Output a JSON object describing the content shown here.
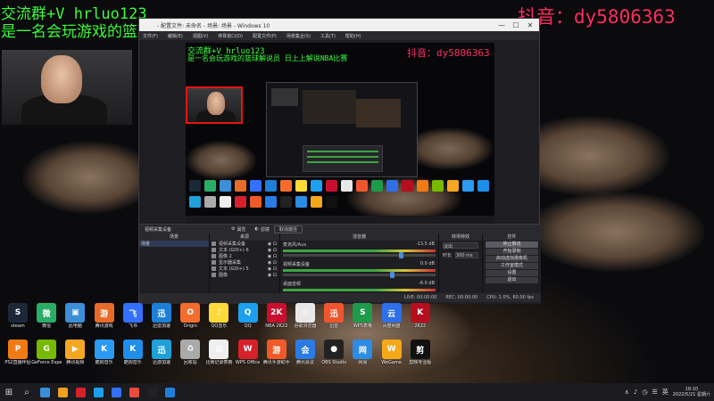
{
  "overlay": {
    "group_text": "交流群+V hrluo123",
    "intro_text": "是一名会玩游戏的篮球解说员，日上上解说NBA比赛",
    "douyin_text": "抖音：dy5806363"
  },
  "obs": {
    "window_title": "- 配置文件: 未命名 - 场景: 场景 - Windows 10",
    "window_buttons": [
      "—",
      "☐",
      "✕"
    ],
    "menu": [
      "文件(F)",
      "编辑(E)",
      "视图(V)",
      "停靠窗口(D)",
      "配置文件(P)",
      "场景集合(S)",
      "工具(T)",
      "帮助(H)"
    ],
    "preview": {
      "group_text": "交流群+V hrluo123",
      "intro_text": "是一名会玩游戏的篮球解说员 日上上解说NBA比赛",
      "douyin_text": "抖音：dy5806363"
    },
    "toolbar": {
      "source_name": "视频采集设备",
      "properties_label": "属性",
      "filters_label": "滤镜",
      "deactivate_label": "取消激活"
    },
    "docks": {
      "scenes": {
        "title": "场景",
        "items": [
          "场景"
        ]
      },
      "sources": {
        "title": "来源",
        "items": [
          "视频采集设备",
          "文本 (GDI+) 6",
          "图像 2",
          "显示器采集",
          "文本 (GDI+) 5",
          "图像"
        ]
      },
      "mixer": {
        "title": "混音器",
        "channels": [
          {
            "name": "麦克风/Aux",
            "db": "-13.5 dB",
            "level": 0.78
          },
          {
            "name": "视频采集设备",
            "db": "0.0 dB",
            "level": 0.72
          },
          {
            "name": "桌面音频",
            "db": "-6.0 dB",
            "level": 0.64
          }
        ]
      },
      "transitions": {
        "title": "转场特效",
        "type": "淡出",
        "duration_label": "时长",
        "duration": "300 ms"
      },
      "controls": {
        "title": "控件",
        "buttons": [
          "停止推流",
          "开始录制",
          "启动虚拟摄像机",
          "工作室模式",
          "设置",
          "退出"
        ]
      }
    },
    "status": {
      "live": "LIVE: 00:00:00",
      "rec": "REC: 00:00:00",
      "cpu": "CPU: 1.0%, 60.00 fps"
    },
    "footer_glyphs": [
      "+",
      "—",
      "∧",
      "∨"
    ]
  },
  "desktop_row1": [
    {
      "label": "steam",
      "color": "#1b2838",
      "glyph": "S"
    },
    {
      "label": "微信",
      "color": "#2aae67",
      "glyph": "微"
    },
    {
      "label": "此电脑",
      "color": "#3b8fd9",
      "glyph": "▣"
    },
    {
      "label": "腾讯游戏",
      "color": "#e86a2a",
      "glyph": "游"
    },
    {
      "label": "飞书",
      "color": "#3370ff",
      "glyph": "飞"
    },
    {
      "label": "迅雷加速",
      "color": "#1e7fd8",
      "glyph": "迅"
    },
    {
      "label": "Origin",
      "color": "#f56c2d",
      "glyph": "O"
    },
    {
      "label": "QQ音乐",
      "color": "#ffd93a",
      "glyph": "♪"
    },
    {
      "label": "QQ",
      "color": "#1ea0f0",
      "glyph": "Q"
    },
    {
      "label": "NBA 2K22",
      "color": "#c8102e",
      "glyph": "2K"
    },
    {
      "label": "谷歌浏览器",
      "color": "#e8e8e8",
      "glyph": "◎"
    },
    {
      "label": "迅雷",
      "color": "#f0562d",
      "glyph": "迅"
    },
    {
      "label": "WPS表格",
      "color": "#1e9a4b",
      "glyph": "S"
    },
    {
      "label": "百度网盘",
      "color": "#2f6fe8",
      "glyph": "云"
    },
    {
      "label": "2K22",
      "color": "#b50f1f",
      "glyph": "K"
    }
  ],
  "desktop_row2": [
    {
      "label": "PS2直播伴侣",
      "color": "#f07a14",
      "glyph": "P"
    },
    {
      "label": "GeForce Experience",
      "color": "#76b900",
      "glyph": "G"
    },
    {
      "label": "腾讯视频",
      "color": "#f5a623",
      "glyph": "▶"
    },
    {
      "label": "酷狗音乐",
      "color": "#2b9af3",
      "glyph": "K"
    },
    {
      "label": "酷狗音乐",
      "color": "#1e8ee8",
      "glyph": "K"
    },
    {
      "label": "迅游加速",
      "color": "#1fa0d8",
      "glyph": "迅"
    },
    {
      "label": "回收站",
      "color": "#aaa",
      "glyph": "♻"
    },
    {
      "label": "比赛记录表格",
      "color": "#eee",
      "glyph": "▤"
    },
    {
      "label": "WPS Office",
      "color": "#d7202a",
      "glyph": "W"
    },
    {
      "label": "腾讯手游助手",
      "color": "#f05a28",
      "glyph": "游"
    },
    {
      "label": "腾讯会议",
      "color": "#2a7be4",
      "glyph": "会"
    },
    {
      "label": "OBS Studio",
      "color": "#222",
      "glyph": "●"
    },
    {
      "label": "网易",
      "color": "#2d8ce3",
      "glyph": "网"
    },
    {
      "label": "WeGame",
      "color": "#f5a71a",
      "glyph": "W"
    },
    {
      "label": "剪映专业版",
      "color": "#111",
      "glyph": "剪"
    }
  ],
  "taskbar": {
    "start_glyph": "⊞",
    "search_glyph": "⌕",
    "apps": [
      {
        "color": "#3b8fd9"
      },
      {
        "color": "#f0a020"
      },
      {
        "color": "#d7202a"
      },
      {
        "color": "#1ea0f0"
      },
      {
        "color": "#3370ff"
      },
      {
        "color": "#e74c3c"
      },
      {
        "color": "#222"
      },
      {
        "color": "#1e7fd8"
      }
    ],
    "tray_icons": [
      "∧",
      "♪",
      "◷",
      "☰",
      "英"
    ],
    "time": "18:10",
    "date": "2022/5/21 星期六"
  }
}
